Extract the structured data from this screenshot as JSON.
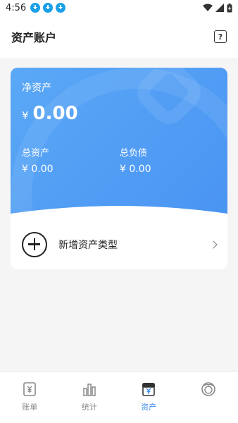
{
  "status_bar": {
    "time": "4:56"
  },
  "header": {
    "title": "资产账户",
    "help_label": "?"
  },
  "card": {
    "net_assets_label": "净资产",
    "currency_symbol": "¥",
    "net_assets_value": "0.00",
    "total_assets_label": "总资产",
    "total_assets_value": "¥ 0.00",
    "total_liabilities_label": "总负债",
    "total_liabilities_value": "¥ 0.00",
    "gradient_colors": [
      "#5aa8f7",
      "#4a94f2"
    ]
  },
  "add_row": {
    "label": "新增资产类型"
  },
  "tabs": [
    {
      "label": "账单",
      "icon": "bill-icon",
      "active": false
    },
    {
      "label": "统计",
      "icon": "chart-icon",
      "active": false
    },
    {
      "label": "资产",
      "icon": "asset-icon",
      "active": true
    },
    {
      "label": "",
      "icon": "profile-icon",
      "active": false
    }
  ],
  "colors": {
    "accent": "#3a8cf0",
    "inactive": "#888888"
  }
}
